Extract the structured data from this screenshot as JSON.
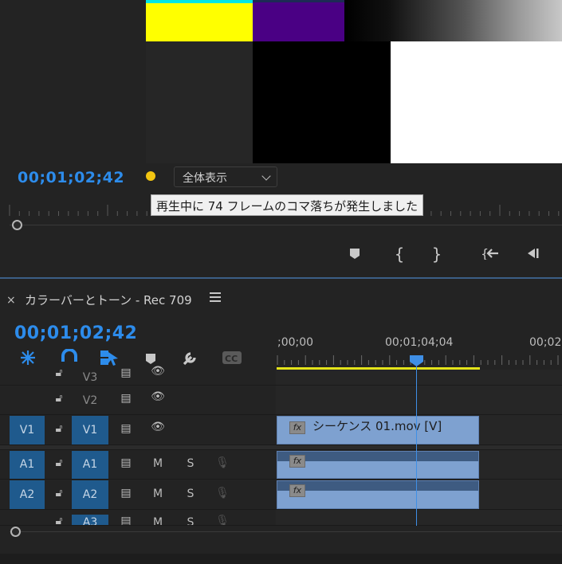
{
  "monitor": {
    "timecode": "00;01;02;42",
    "zoom_select": "全体表示",
    "tooltip": "再生中に 74 フレームのコマ落ちが発生しました",
    "colors": {
      "accent": "#2d8ceb",
      "dropped_frame_indicator": "#f2c511",
      "bars": [
        "#00e6e6",
        "#ffff00",
        "#4a0084",
        "#000000",
        "#ffffff"
      ]
    },
    "transport_icons": [
      "add-marker-icon",
      "mark-in-icon",
      "mark-out-icon",
      "go-to-in-icon",
      "step-back-icon"
    ]
  },
  "timeline": {
    "title": "カラーバーとトーン - Rec 709",
    "timecode": "00;01;02;42",
    "tools": [
      "snap-icon",
      "magnet-icon",
      "linked-selection-icon",
      "add-marker-icon",
      "wrench-icon",
      "captions-icon"
    ],
    "ruler_labels": [
      ";00;00",
      "00;01;04;04",
      "00;02"
    ],
    "tracks": [
      {
        "id": "V3",
        "source": "",
        "target": "V3",
        "type": "video"
      },
      {
        "id": "V2",
        "source": "",
        "target": "V2",
        "type": "video"
      },
      {
        "id": "V1",
        "source": "V1",
        "target": "V1",
        "type": "video"
      },
      {
        "id": "A1",
        "source": "A1",
        "target": "A1",
        "type": "audio",
        "mute": "M",
        "solo": "S"
      },
      {
        "id": "A2",
        "source": "A2",
        "target": "A2",
        "type": "audio",
        "mute": "M",
        "solo": "S"
      },
      {
        "id": "A3",
        "source": "",
        "target": "A3",
        "type": "audio",
        "mute": "M",
        "solo": "S"
      }
    ],
    "clips": {
      "v1": {
        "name": "シーケンス 01.mov [V]",
        "fx": "fx"
      },
      "a1": {
        "fx": "fx"
      },
      "a2": {
        "fx": "fx"
      }
    }
  }
}
